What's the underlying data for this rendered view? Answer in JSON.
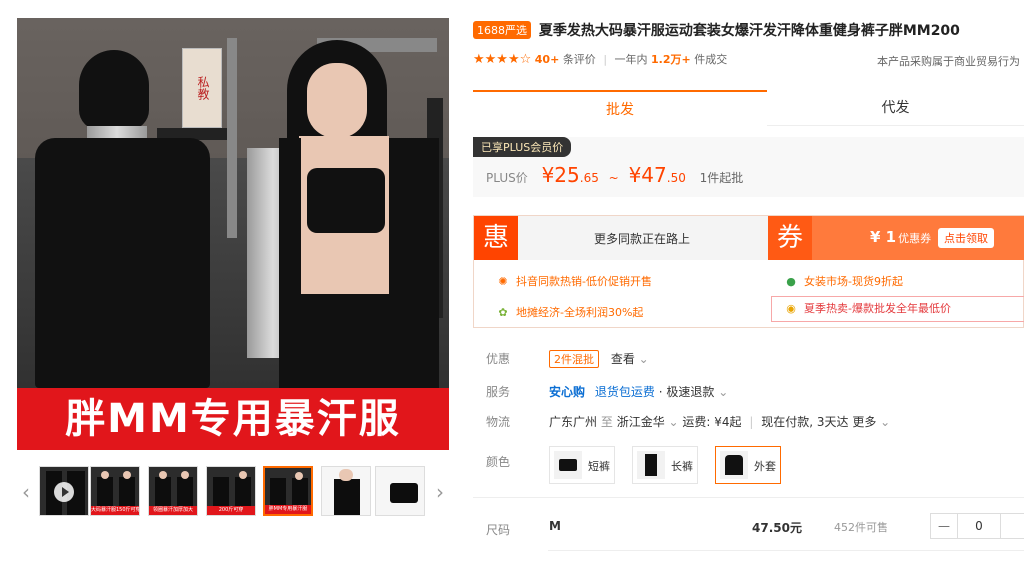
{
  "gallery": {
    "banner_text": "胖MM专用暴汗服",
    "sign_text": "私教",
    "prev_arrow": "‹",
    "next_arrow": "›",
    "thumb_band_texts": [
      "大码暴汗服150斤可穿",
      "领圈暴汗加厚加大",
      "200斤可穿",
      "胖MM专用暴汗服"
    ]
  },
  "product": {
    "badge": "1688严选",
    "title": "夏季发热大码暴汗服运动套装女爆汗发汗降体重健身裤子胖MM200",
    "rating_stars": "★★★★☆",
    "review_count": "40+",
    "review_label": "条评价",
    "sales_prefix": "一年内",
    "sales_count": "1.2万+",
    "sales_label": "件成交",
    "trade_note": "本产品采购属于商业贸易行为"
  },
  "tabs": [
    "批发",
    "代发"
  ],
  "price": {
    "plus_tag": "已享PLUS会员价",
    "label": "PLUS价",
    "low_int": "¥25",
    "low_dec": ".65",
    "tilde": "~",
    "high_int": "¥47",
    "high_dec": ".50",
    "min_order": "1件起批"
  },
  "promo": {
    "hui": "惠",
    "left_text": "更多同款正在路上",
    "quan": "券",
    "coupon_amount": "¥ 1",
    "coupon_label": "优惠券",
    "coupon_button": "点击领取",
    "items": [
      {
        "icon": "✺",
        "text": "抖音同款热销-低价促销开售"
      },
      {
        "icon": "●",
        "text": "女装市场-现货9折起"
      },
      {
        "icon": "✿",
        "text": "地摊经济-全场利润30%起"
      },
      {
        "icon": "◉",
        "text": "夏季热卖-爆款批发全年最低价"
      }
    ]
  },
  "attributes": {
    "discount": {
      "label": "优惠",
      "tag": "2件混批",
      "link": "查看"
    },
    "service": {
      "label": "服务",
      "safe": "安心购",
      "return": "退货包运费",
      "dot": "·",
      "refund": "极速退款"
    },
    "logistics": {
      "label": "物流",
      "from": "广东广州",
      "to_word": "至",
      "to": "浙江金华",
      "fee": "运费: ¥4起",
      "pay": "现在付款, 3天达",
      "more": "更多"
    },
    "color": {
      "label": "颜色",
      "options": [
        "短裤",
        "长裤",
        "外套"
      ]
    }
  },
  "size": {
    "label": "尺码",
    "name": "M",
    "price": "47.50元",
    "stock": "452件可售",
    "minus": "—",
    "qty": "0"
  },
  "colors": {
    "accent": "#ff6a00",
    "price": "#ff4400",
    "banner_red": "#e1161b"
  }
}
